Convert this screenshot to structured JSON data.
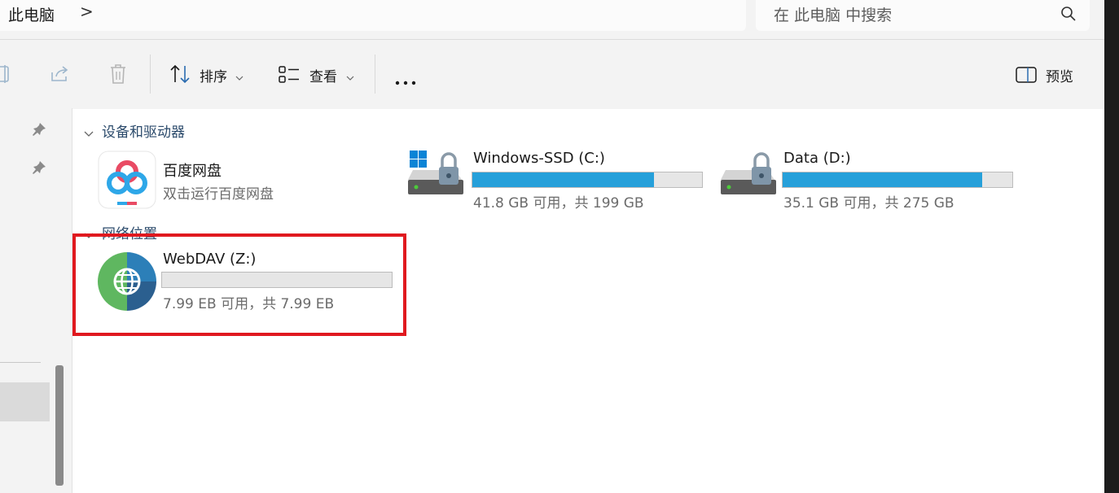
{
  "address": {
    "crumb": "此电脑",
    "separator": ">"
  },
  "search": {
    "placeholder": "在 此电脑 中搜索"
  },
  "toolbar": {
    "sort_label": "排序",
    "view_label": "查看",
    "more_label": "···",
    "preview_label": "预览"
  },
  "groups": {
    "devices": "设备和驱动器",
    "network": "网络位置"
  },
  "items": {
    "baidu": {
      "title": "百度网盘",
      "subtitle": "双击运行百度网盘"
    },
    "c_drive": {
      "title": "Windows-SSD (C:)",
      "info": "41.8 GB 可用，共 199 GB",
      "used_fraction": 0.79
    },
    "d_drive": {
      "title": "Data (D:)",
      "info": "35.1 GB 可用，共 275 GB",
      "used_fraction": 0.87
    },
    "webdav": {
      "title": "WebDAV (Z:)",
      "info": "7.99 EB 可用，共 7.99 EB",
      "used_fraction": 0.0
    }
  },
  "colors": {
    "bar_fill": "#26a0da",
    "highlight": "#e0191f"
  }
}
